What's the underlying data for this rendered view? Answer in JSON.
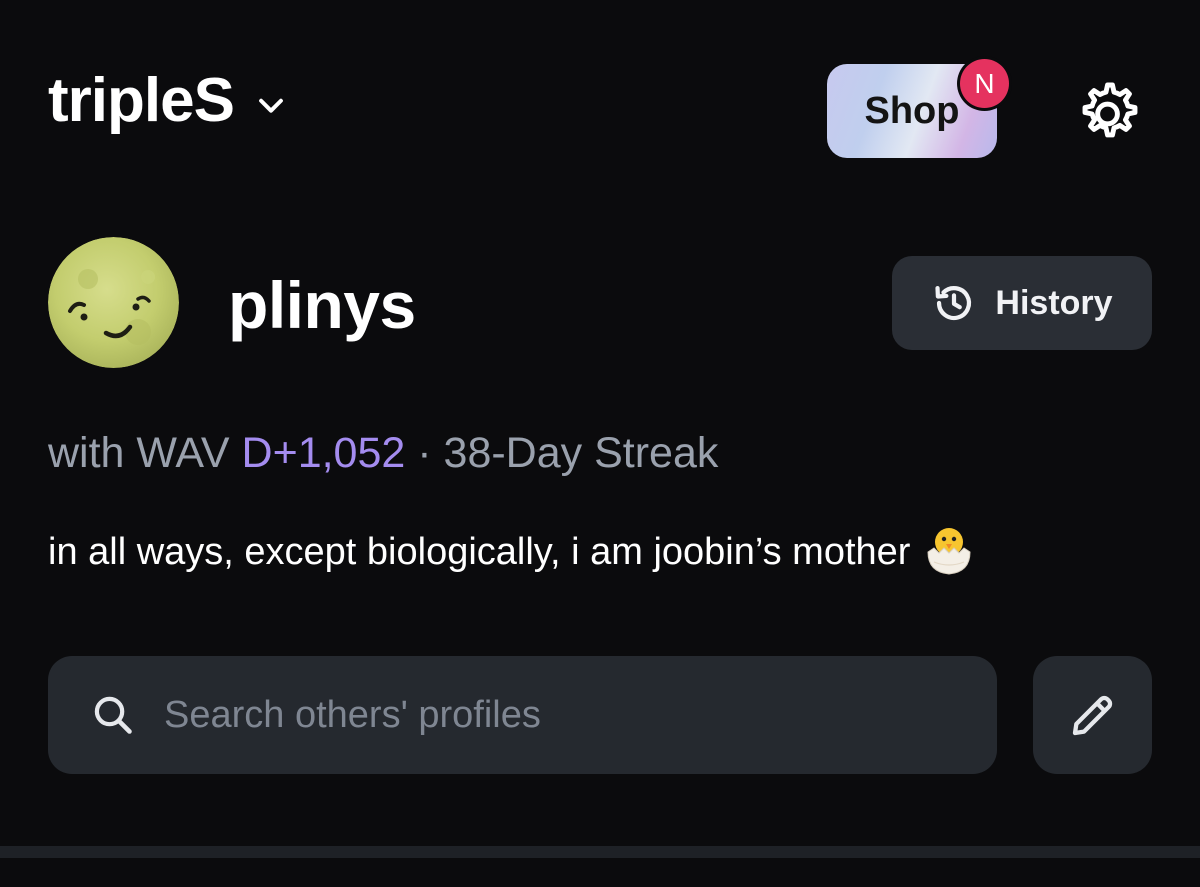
{
  "header": {
    "app_title": "tripleS",
    "shop_label": "Shop",
    "shop_badge": "N",
    "icons": [
      "chevron-down-icon",
      "gear-icon"
    ]
  },
  "profile": {
    "username": "plinys",
    "history_label": "History",
    "stats": {
      "prefix": "with WAV ",
      "days": "D+1,052",
      "separator": " · ",
      "streak": "38-Day Streak"
    },
    "bio": "in all ways, except biologically, i am joobin’s mother",
    "bio_emoji_icon": "hatching-chick-icon"
  },
  "search": {
    "placeholder": "Search others' profiles",
    "value": ""
  },
  "colors": {
    "background": "#0b0b0d",
    "surface": "#25292f",
    "accent_days": "#a48cef",
    "badge": "#e5325f",
    "muted_text": "#9aa1ad"
  }
}
